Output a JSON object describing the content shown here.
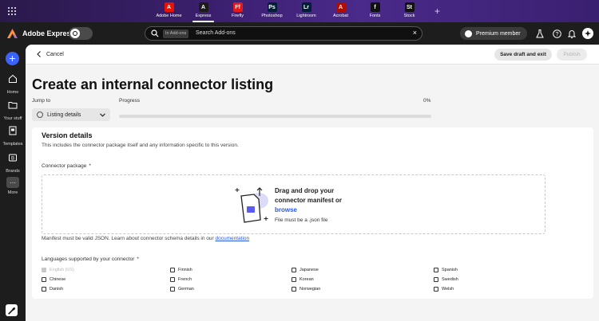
{
  "apps": [
    {
      "label": "Adobe Home",
      "glyph": "A",
      "color": "#eb1000",
      "active": false
    },
    {
      "label": "Express",
      "glyph": "A",
      "color": "#1c1c1c",
      "active": true
    },
    {
      "label": "Firefly",
      "glyph": "Ff",
      "color": "#e5181b",
      "active": false
    },
    {
      "label": "Photoshop",
      "glyph": "Ps",
      "color": "#001e36",
      "active": false
    },
    {
      "label": "Lightroom",
      "glyph": "Lr",
      "color": "#001e36",
      "active": false
    },
    {
      "label": "Acrobat",
      "glyph": "A",
      "color": "#b30b00",
      "active": false
    },
    {
      "label": "Fonts",
      "glyph": "f",
      "color": "#111111",
      "active": false
    },
    {
      "label": "Stock",
      "glyph": "St",
      "color": "#111111",
      "active": false
    }
  ],
  "header": {
    "brand": "Adobe Express",
    "search_scope": "In Add-ons",
    "search_placeholder": "Search Add-ons",
    "member_label": "Premium member"
  },
  "rail": {
    "home": "Home",
    "your_stuff": "Your stuff",
    "templates": "Templates",
    "brands": "Brands",
    "more": "More"
  },
  "subbar": {
    "cancel": "Cancel",
    "save": "Save draft and exit",
    "publish": "Publish"
  },
  "page": {
    "title": "Create an internal connector listing",
    "jump_label": "Jump to",
    "jump_value": "Listing details",
    "progress_label": "Progress",
    "progress_text": "0%",
    "progress_value": 0
  },
  "version": {
    "heading": "Version details",
    "description": "This includes the connector package itself and any information specific to this version.",
    "package_label": "Connector package",
    "required_mark": "*",
    "drop_title_1": "Drag and drop your",
    "drop_title_2": "connector manifest or",
    "drop_link": "browse",
    "drop_note": "File must be a .json file",
    "manifest_text": "Manifest must be valid JSON. Learn about connector schema details in our ",
    "manifest_link": "documentation",
    "languages_label": "Languages supported by your connector"
  },
  "languages": [
    {
      "name": "English (US)",
      "disabled": true,
      "checked": true
    },
    {
      "name": "Finnish"
    },
    {
      "name": "Japanese"
    },
    {
      "name": "Spanish"
    },
    {
      "name": "Chinese"
    },
    {
      "name": "French"
    },
    {
      "name": "Korean"
    },
    {
      "name": "Swedish"
    },
    {
      "name": "Danish"
    },
    {
      "name": "German"
    },
    {
      "name": "Norwegian"
    },
    {
      "name": "Welsh"
    }
  ],
  "colors": {
    "accent": "#3b63fb",
    "link": "#2a5be0",
    "chrome": "#1d1d1d"
  }
}
